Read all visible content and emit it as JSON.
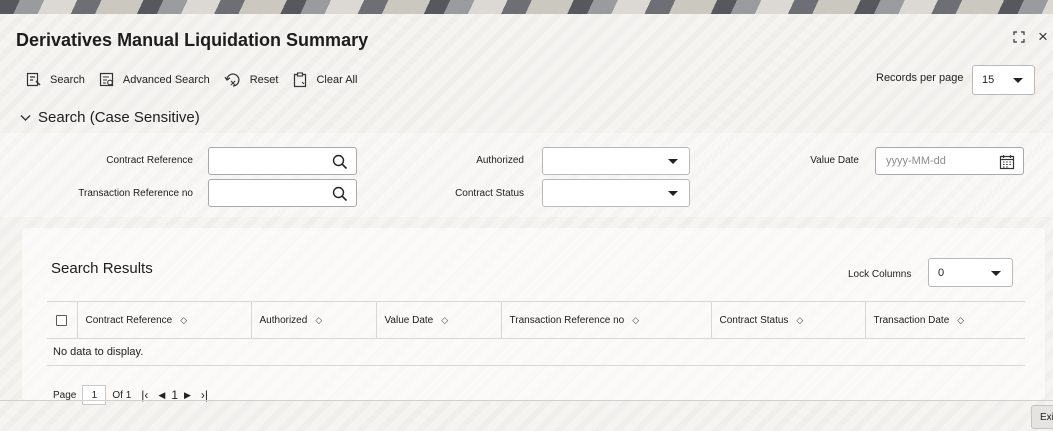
{
  "window": {
    "title": "Derivatives Manual Liquidation Summary",
    "maximize_icon": "expand-icon",
    "close_label": "×"
  },
  "toolbar": {
    "search_label": "Search",
    "advanced_search_label": "Advanced Search",
    "reset_label": "Reset",
    "clear_all_label": "Clear All"
  },
  "records_per_page": {
    "label": "Records per page",
    "value": "15"
  },
  "search_section": {
    "title": "Search (Case Sensitive)",
    "contract_reference_label": "Contract Reference",
    "transaction_reference_label": "Transaction Reference no",
    "authorized_label": "Authorized",
    "contract_status_label": "Contract Status",
    "value_date_label": "Value Date",
    "value_date_placeholder": "yyyy-MM-dd"
  },
  "results": {
    "title": "Search Results",
    "lock_columns_label": "Lock Columns",
    "lock_columns_value": "0",
    "columns": [
      "Contract Reference",
      "Authorized",
      "Value Date",
      "Transaction Reference no",
      "Contract Status",
      "Transaction Date"
    ],
    "empty_message": "No data to display."
  },
  "pager": {
    "page_label": "Page",
    "current_page": "1",
    "of_label": "Of 1",
    "page_number": "1"
  },
  "footer": {
    "exit_label": "Exi"
  }
}
